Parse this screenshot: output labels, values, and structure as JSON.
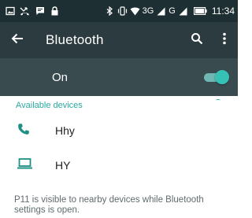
{
  "status_bar": {
    "network_text": "3G",
    "signal2_text": "G",
    "time": "11:34",
    "icons": [
      "picture-icon",
      "missed-call-icon",
      "message-icon",
      "lock-icon",
      "bluetooth-icon",
      "vibrate-icon",
      "wifi-icon",
      "signal-icon",
      "signal-icon",
      "battery-icon"
    ]
  },
  "toolbar": {
    "title": "Bluetooth",
    "back_icon": "back-arrow-icon",
    "search_icon": "search-icon",
    "more_icon": "more-vert-icon"
  },
  "master_switch": {
    "label": "On",
    "checked": true
  },
  "devices": {
    "section_title": "Available devices",
    "items": [
      {
        "name": "Hhy",
        "icon": "phone-icon"
      },
      {
        "name": "HY",
        "icon": "laptop-icon"
      }
    ]
  },
  "footer": {
    "text": "P11 is visible to nearby devices while Bluetooth settings is open."
  },
  "colors": {
    "status_bar_bg": "#1e2f33",
    "toolbar_bg": "#2b3b40",
    "switch_row_bg": "#3a4b50",
    "accent": "#2aa99e"
  }
}
